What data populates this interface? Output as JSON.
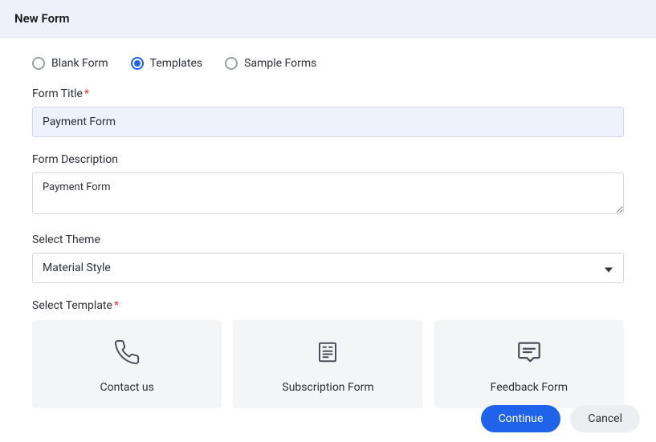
{
  "header": {
    "title": "New Form"
  },
  "radios": {
    "blank": "Blank Form",
    "templates": "Templates",
    "sample": "Sample Forms",
    "selected": "templates"
  },
  "fields": {
    "title_label": "Form Title",
    "title_value": "Payment Form",
    "desc_label": "Form Description",
    "desc_value": "Payment Form",
    "theme_label": "Select Theme",
    "theme_value": "Material Style",
    "template_label": "Select Template"
  },
  "templates": {
    "contact": "Contact us",
    "subscription": "Subscription Form",
    "feedback": "Feedback Form"
  },
  "footer": {
    "continue": "Continue",
    "cancel": "Cancel"
  }
}
